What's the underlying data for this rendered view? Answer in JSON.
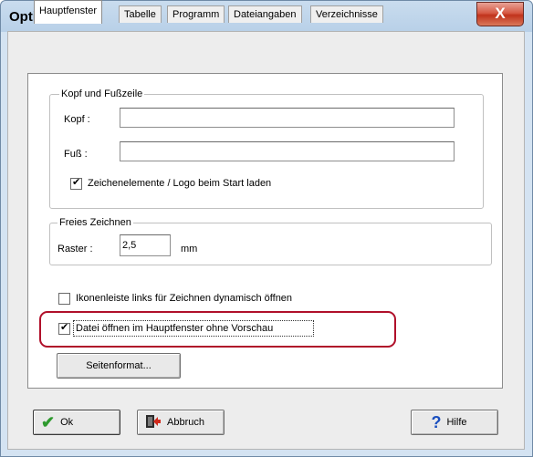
{
  "window": {
    "title": "Optionen",
    "close_label": "X"
  },
  "tabs": [
    {
      "label": "Hauptfenster",
      "active": true
    },
    {
      "label": "Tabelle"
    },
    {
      "label": "Programm"
    },
    {
      "label": "Dateiangaben"
    },
    {
      "label": "Verzeichnisse"
    }
  ],
  "header_footer": {
    "legend": "Kopf und Fußzeile",
    "kopf_label": "Kopf :",
    "kopf_value": "",
    "fuss_label": "Fuß :",
    "fuss_value": "",
    "logo_checkbox_label": "Zeichenelemente / Logo beim Start laden",
    "logo_checked": true
  },
  "free_drawing": {
    "legend": "Freies Zeichnen",
    "raster_label": "Raster :",
    "raster_value": "2,5",
    "unit": "mm"
  },
  "options": {
    "icon_bar_label": "Ikonenleiste links für Zeichnen dynamisch öffnen",
    "icon_bar_checked": false,
    "open_file_label": "Datei öffnen im Hauptfenster ohne Vorschau",
    "open_file_checked": true
  },
  "page_format_button": "Seitenformat...",
  "footer": {
    "ok_label": "Ok",
    "cancel_label": "Abbruch",
    "help_label": "Hilfe"
  },
  "colors": {
    "highlight": "#b0102a",
    "ok_check": "#2e9a2e",
    "help_icon": "#1a4fbf"
  }
}
